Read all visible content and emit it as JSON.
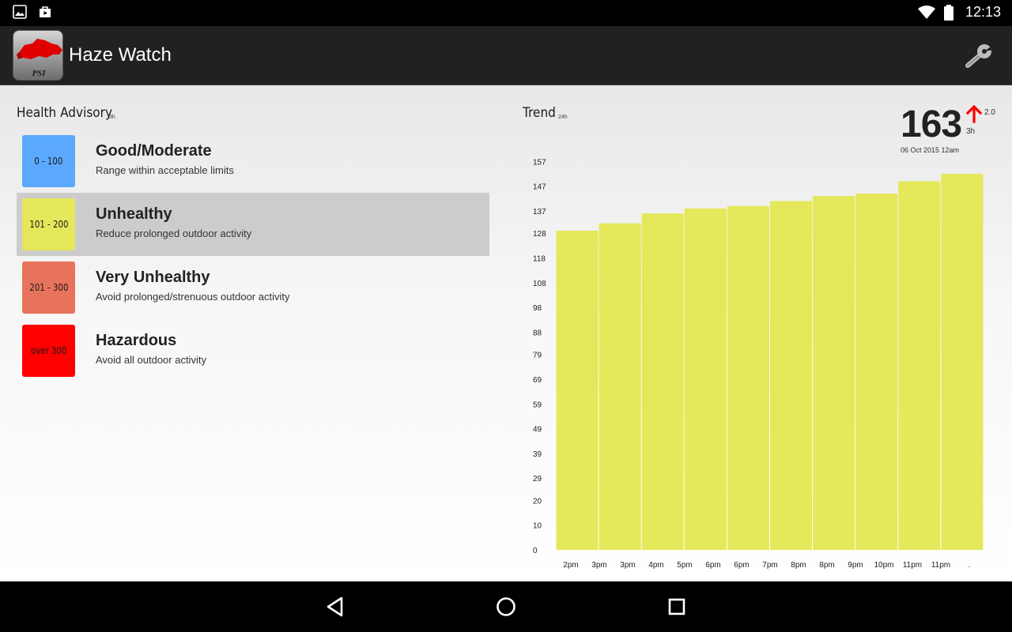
{
  "status_bar": {
    "time": "12:13",
    "left_icons": [
      "image-icon",
      "play-store-icon"
    ],
    "right_icons": [
      "wifi-icon",
      "battery-icon"
    ]
  },
  "app_bar": {
    "title": "Haze Watch",
    "logo_text": "PSI",
    "settings_icon": "wrench-icon"
  },
  "advisory": {
    "title": "Health Advisory",
    "subtitle": "3h",
    "items": [
      {
        "range": "0 - 100",
        "name": "Good/Moderate",
        "desc": "Range within acceptable limits",
        "color": "#5aa9ff",
        "selected": false
      },
      {
        "range": "101 - 200",
        "name": "Unhealthy",
        "desc": "Reduce prolonged outdoor activity",
        "color": "#e4e85a",
        "selected": true
      },
      {
        "range": "201 - 300",
        "name": "Very Unhealthy",
        "desc": "Avoid prolonged/strenuous outdoor activity",
        "color": "#e8735c",
        "selected": false
      },
      {
        "range": "over 300",
        "name": "Hazardous",
        "desc": "Avoid all outdoor activity",
        "color": "#ff0000",
        "selected": false
      }
    ]
  },
  "trend": {
    "title": "Trend",
    "subtitle": "24h",
    "current_value": "163",
    "change": "2.0",
    "change_period": "3h",
    "timestamp": "06 Oct 2015 12am",
    "arrow_color": "#ff0000"
  },
  "chart_data": {
    "type": "bar",
    "categories": [
      "2pm",
      "3pm",
      "3pm",
      "4pm",
      "5pm",
      "6pm",
      "6pm",
      "7pm",
      "8pm",
      "8pm",
      "9pm",
      "10pm",
      "11pm",
      "11pm",
      "."
    ],
    "values": [
      129,
      132,
      136,
      138,
      139,
      141,
      143,
      144,
      149,
      152
    ],
    "y_ticks": [
      "0",
      "10",
      "20",
      "29",
      "39",
      "49",
      "59",
      "69",
      "79",
      "88",
      "98",
      "108",
      "118",
      "128",
      "137",
      "147",
      "157"
    ],
    "ylim": [
      0,
      160
    ],
    "bar_color": "#e4e85a",
    "grid": false,
    "title": "",
    "xlabel": "",
    "ylabel": ""
  },
  "nav_bar": {
    "buttons": [
      "back-icon",
      "home-icon",
      "recents-icon"
    ]
  }
}
